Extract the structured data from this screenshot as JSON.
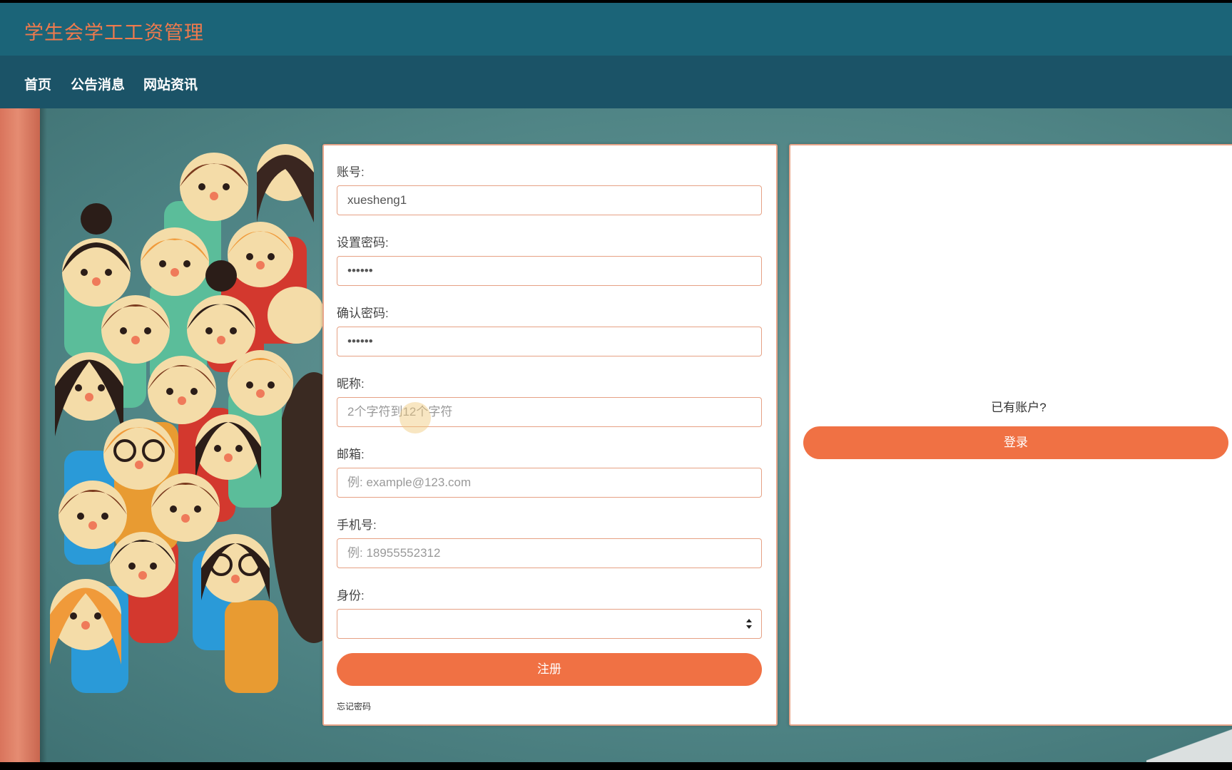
{
  "header": {
    "site_title": "学生会学工工资管理"
  },
  "nav": {
    "items": [
      {
        "label": "首页"
      },
      {
        "label": "公告消息"
      },
      {
        "label": "网站资讯"
      }
    ]
  },
  "register_form": {
    "account": {
      "label": "账号:",
      "value": "xuesheng1"
    },
    "password": {
      "label": "设置密码:",
      "value": "••••••"
    },
    "confirm_password": {
      "label": "确认密码:",
      "value": "••••••"
    },
    "nickname": {
      "label": "昵称:",
      "placeholder": "2个字符到12个字符"
    },
    "email": {
      "label": "邮箱:",
      "placeholder": "例: example@123.com"
    },
    "phone": {
      "label": "手机号:",
      "placeholder": "例: 18955552312"
    },
    "identity": {
      "label": "身份:",
      "value": ""
    },
    "submit_label": "注册",
    "forgot_label": "忘记密码"
  },
  "side_panel": {
    "prompt": "已有账户?",
    "login_label": "登录"
  },
  "colors": {
    "header_bg": "#1b6478",
    "nav_bg": "#1b5367",
    "title": "#ef7a4d",
    "accent": "#f07144",
    "input_border": "#e6a184"
  }
}
